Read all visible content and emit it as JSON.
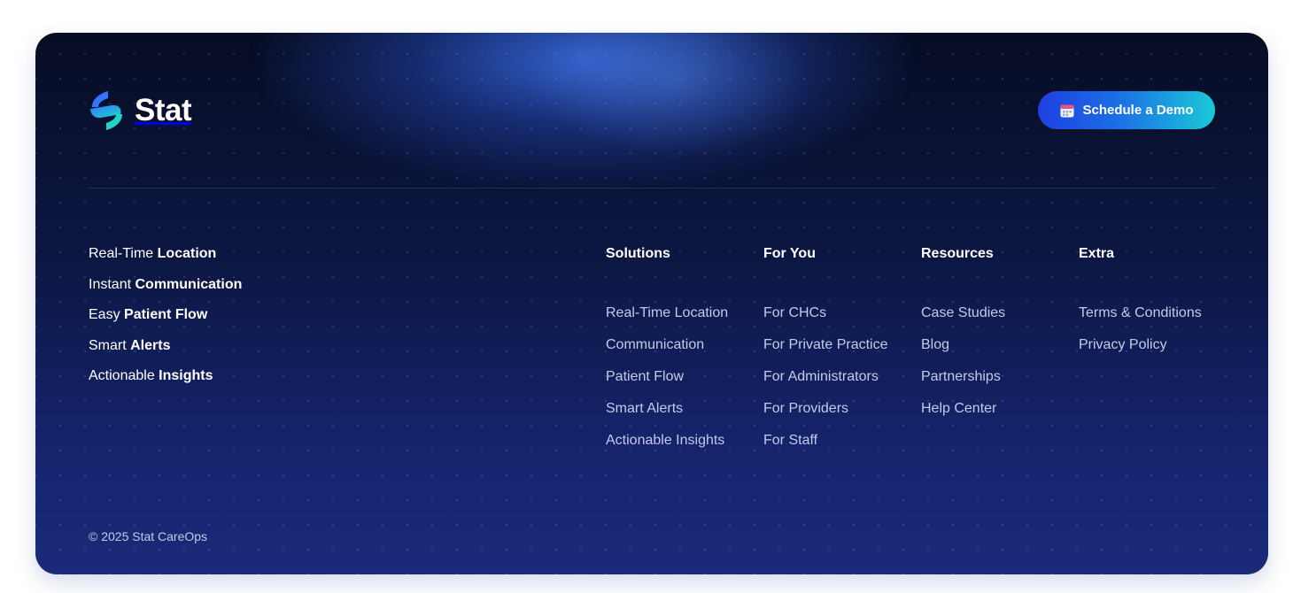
{
  "brand": {
    "name": "Stat",
    "colors": {
      "logo_blue": "#2f6bff",
      "logo_teal": "#22d3c5",
      "button_start": "#1f3fe0",
      "button_end": "#19c9d8",
      "footer_top": "#070d24",
      "footer_bottom": "#1a2b7a"
    }
  },
  "header": {
    "cta_label": "Schedule a Demo",
    "cta_icon": "calendar-icon"
  },
  "taglines": [
    {
      "light": "Real-Time",
      "bold": "Location"
    },
    {
      "light": "Instant",
      "bold": "Communication"
    },
    {
      "light": "Easy",
      "bold": "Patient Flow"
    },
    {
      "light": "Smart",
      "bold": "Alerts"
    },
    {
      "light": "Actionable",
      "bold": "Insights"
    }
  ],
  "columns": [
    {
      "title": "Solutions",
      "links": [
        "Real-Time Location",
        "Communication",
        "Patient Flow",
        "Smart Alerts",
        "Actionable Insights"
      ]
    },
    {
      "title": "For You",
      "links": [
        "For CHCs",
        "For Private Practice",
        "For Administrators",
        "For Providers",
        "For Staff"
      ]
    },
    {
      "title": "Resources",
      "links": [
        "Case Studies",
        "Blog",
        "Partnerships",
        "Help Center"
      ]
    },
    {
      "title": "Extra",
      "links": [
        "Terms & Conditions",
        "Privacy Policy"
      ]
    }
  ],
  "footer": {
    "copyright": "© 2025 Stat CareOps"
  }
}
